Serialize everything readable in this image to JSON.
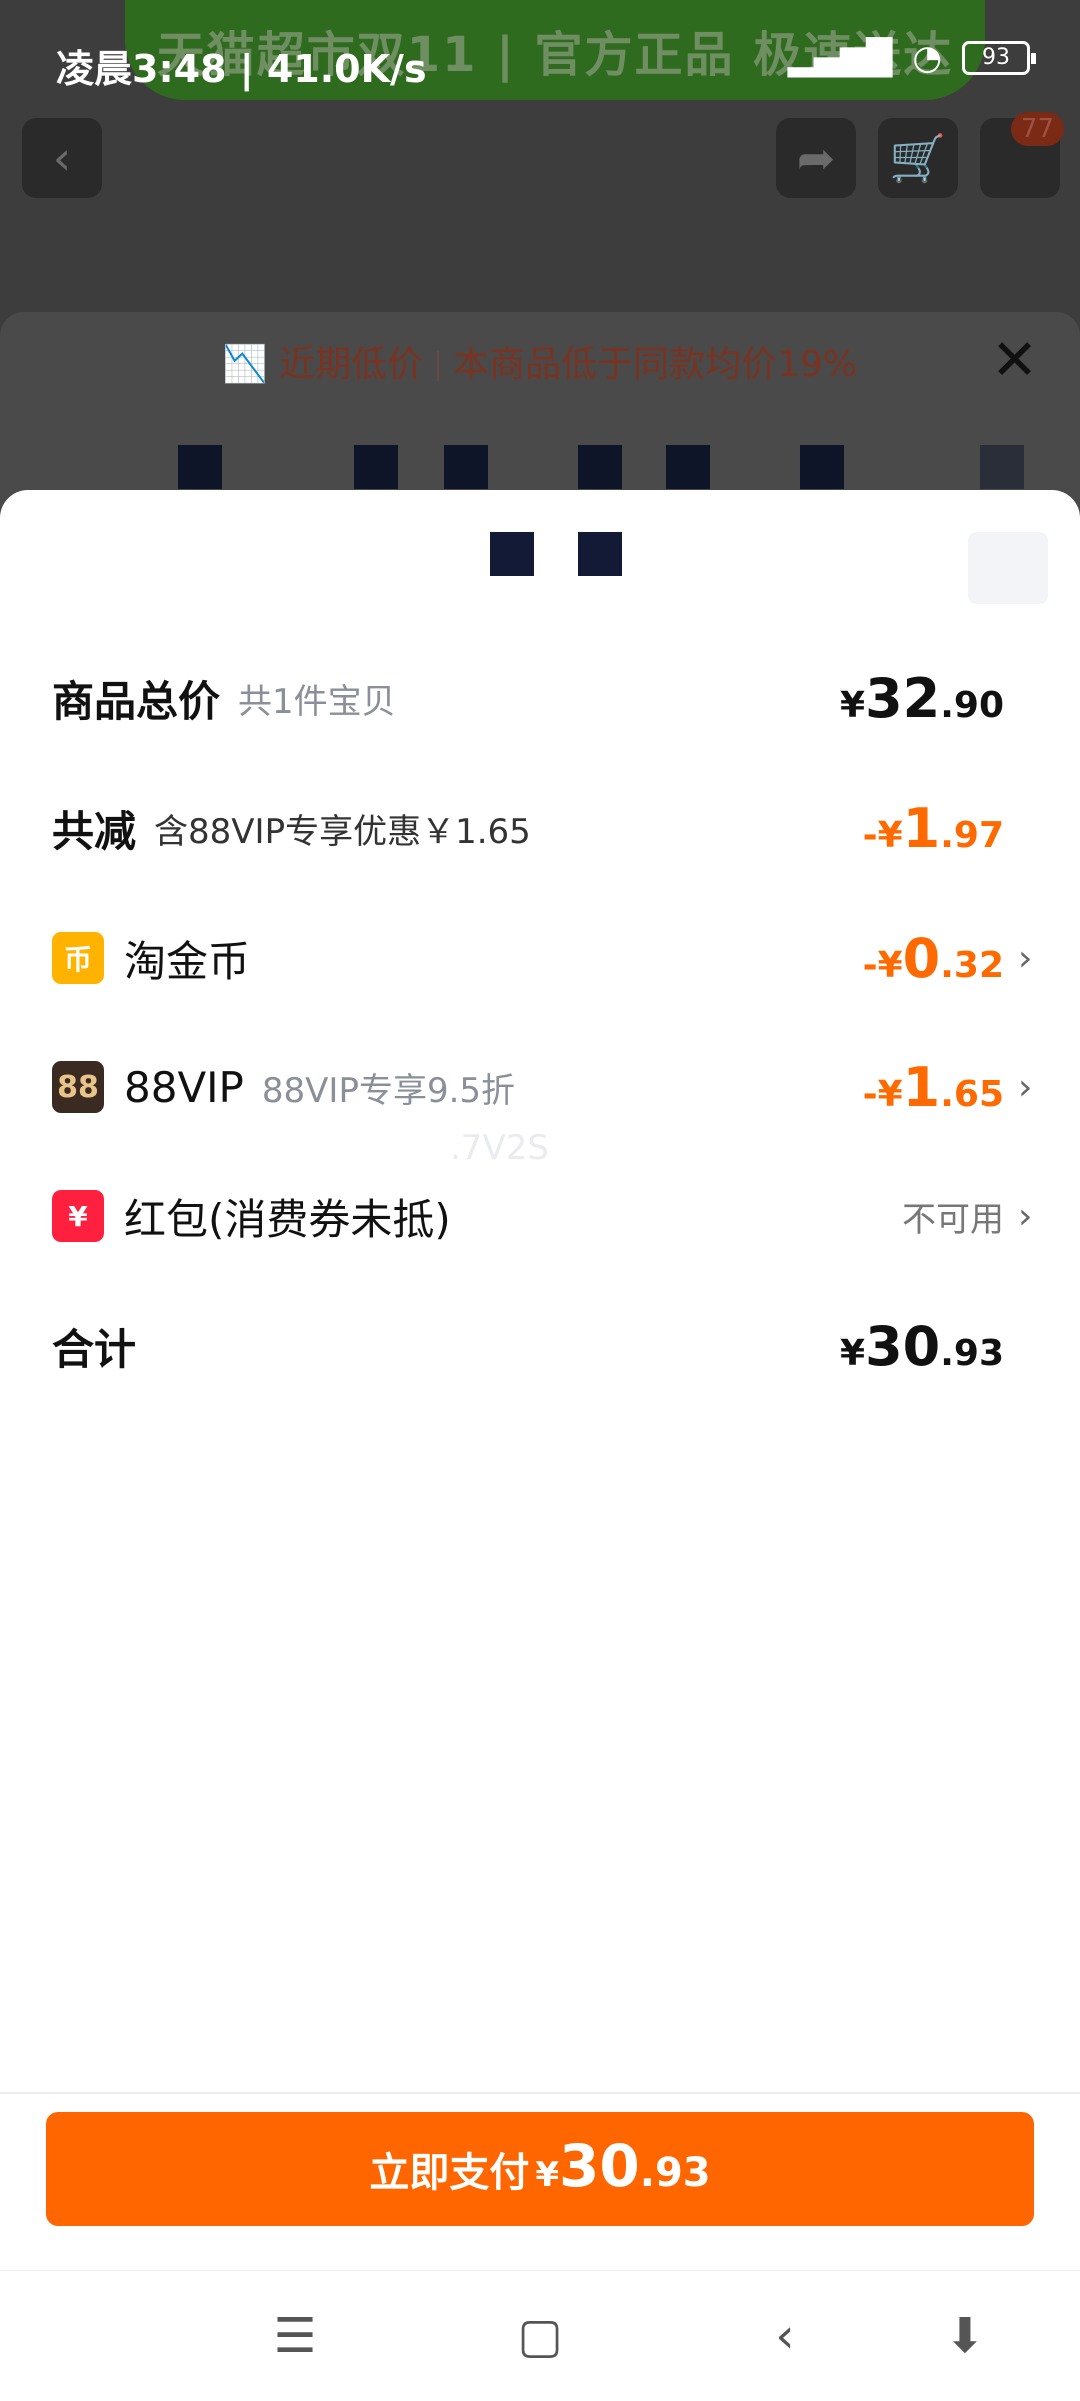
{
  "status_bar": {
    "time_speed": "凌晨3:48 | 41.0K/s",
    "battery": "93"
  },
  "background": {
    "banner_text": "天猫超市双11 | 官方正品 极速送达",
    "cart_badge": "77",
    "low_price_tag": "近期低价",
    "low_price_desc": "本商品低于同款均价19%"
  },
  "summary": {
    "total_label": "商品总价",
    "total_sub": "共1件宝贝",
    "total_amount": {
      "cur": "¥",
      "int": "32",
      "dec": ".90"
    },
    "discount_label": "共减",
    "discount_sub": "含88VIP专享优惠￥1.65",
    "discount_amount": {
      "cur": "-¥",
      "int": "1",
      "dec": ".97"
    },
    "coin_label": "淘金币",
    "coin_amount": {
      "cur": "-¥",
      "int": "0",
      "dec": ".32"
    },
    "vip_label": "88VIP",
    "vip_sub": "88VIP专享9.5折",
    "vip_amount": {
      "cur": "-¥",
      "int": "1",
      "dec": ".65"
    },
    "redpack_label": "红包(消费券未抵)",
    "redpack_status": "不可用",
    "sum_label": "合计",
    "sum_amount": {
      "cur": "¥",
      "int": "30",
      "dec": ".93"
    }
  },
  "pay_button": {
    "label": "立即支付",
    "cur": "¥",
    "int": "30",
    "dec": ".93"
  },
  "watermark": ".7V2S",
  "icons": {
    "coin": "币",
    "vip": "88",
    "redpack": "¥"
  },
  "colors": {
    "accent": "#ff6600",
    "discount": "#ff6a00"
  }
}
